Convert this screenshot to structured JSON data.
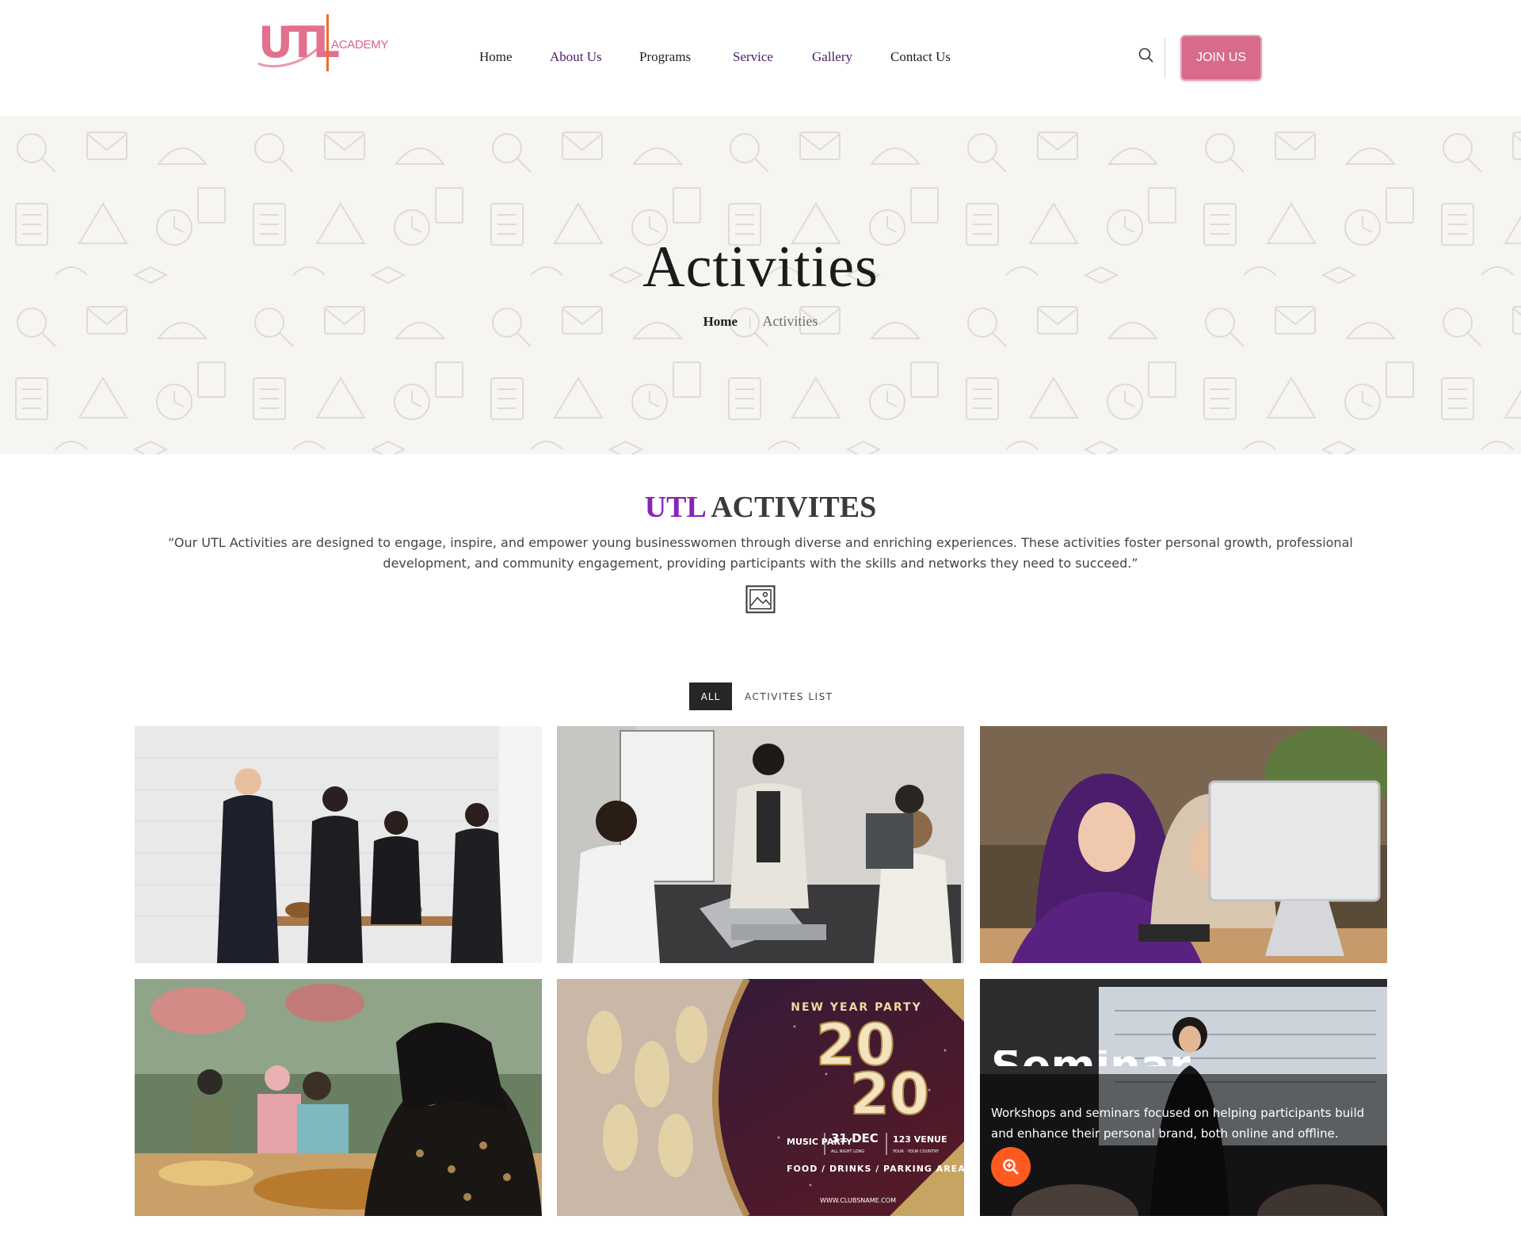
{
  "header": {
    "logo_mark": "UTL",
    "logo_text": "ACADEMY",
    "nav": [
      {
        "label": "Home"
      },
      {
        "label": "About Us"
      },
      {
        "label": "Programs"
      },
      {
        "label": "Service"
      },
      {
        "label": "Gallery"
      },
      {
        "label": "Contact Us"
      }
    ],
    "search_icon": "search-icon",
    "join_label": "JOIN US"
  },
  "hero": {
    "title": "Activities",
    "breadcrumb": {
      "home": "Home",
      "separator": "|",
      "current": "Activities"
    }
  },
  "section": {
    "title_accent": "UTL",
    "title_rest": "ACTIVITES",
    "intro": "“Our UTL Activities are designed to engage, inspire, and empower young businesswomen through diverse and enriching experiences. These activities foster personal growth, professional development, and community engagement, providing participants with the skills and networks they need to succeed.”",
    "icon": "image-icon"
  },
  "filters": {
    "all": "ALL",
    "list": "ACTIVITES LIST"
  },
  "gallery": {
    "tiles": [
      {
        "icon": "photo"
      },
      {
        "icon": "photo"
      },
      {
        "icon": "photo"
      },
      {
        "icon": "photo"
      },
      {
        "poster_heading": "NEW YEAR PARTY",
        "poster_year_top": "20",
        "poster_year_bottom": "20",
        "poster_left": "MUSIC PARTY",
        "poster_date": "31 DEC",
        "poster_date_sub": "ALL NIGHT LONG",
        "poster_venue": "123 VENUE",
        "poster_venue_sub": "YOUR · YOUR COUNTRY",
        "poster_footer": "FOOD / DRINKS / PARKING AREA",
        "poster_url": "WWW.CLUBSNAME.COM"
      },
      {
        "overlay_title": "Seminar",
        "overlay_text": "Workshops and seminars focused on helping participants build and enhance their personal brand, both online and offline.",
        "zoom_icon": "zoom-icon"
      }
    ]
  },
  "colors": {
    "accent_purple": "#8a22b8",
    "nav_purple": "#4b1a6b",
    "join_pink": "#d86a8c",
    "zoom_orange": "#ff5a1f"
  }
}
